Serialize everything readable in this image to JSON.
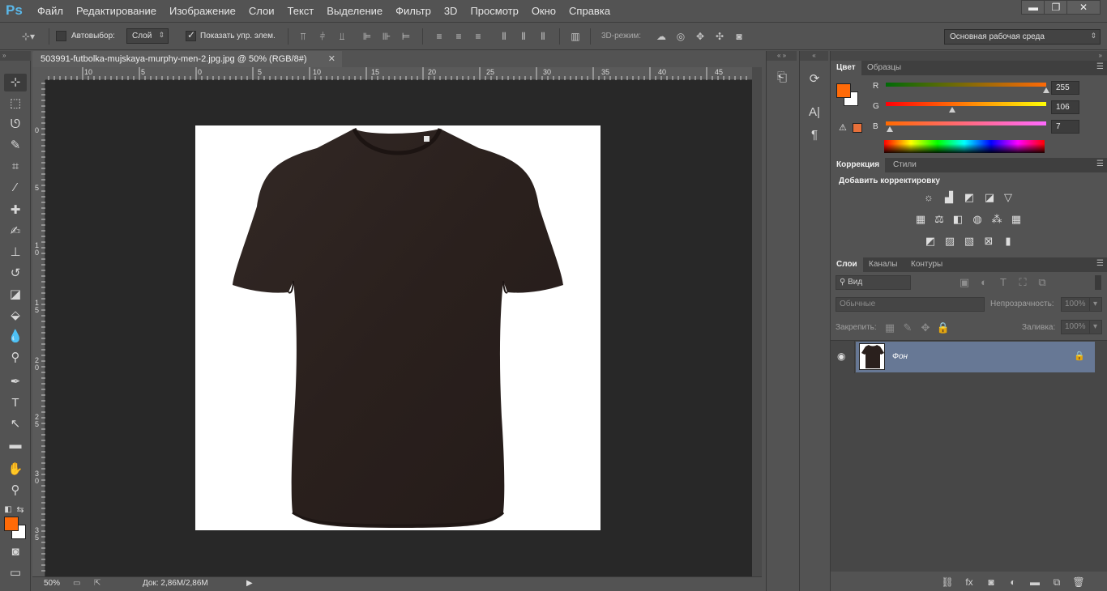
{
  "app": {
    "logo": "Ps",
    "menu": [
      "Файл",
      "Редактирование",
      "Изображение",
      "Слои",
      "Текст",
      "Выделение",
      "Фильтр",
      "3D",
      "Просмотр",
      "Окно",
      "Справка"
    ],
    "window_controls": {
      "minimize": "▬",
      "restore": "❐",
      "close": "✕"
    }
  },
  "options_bar": {
    "autoselect_label": "Автовыбор:",
    "autoselect_checked": false,
    "autoselect_target": "Слой",
    "show_transform_label": "Показать упр. элем.",
    "show_transform_checked": true,
    "mode_3d_label": "3D-режим:",
    "workspace": "Основная рабочая среда"
  },
  "document": {
    "tab_title": "503991-futbolka-mujskaya-murphy-men-2.jpg.jpg @ 50% (RGB/8#)",
    "close_glyph": "✕",
    "ruler_h": [
      "10",
      "5",
      "0",
      "5",
      "10",
      "15",
      "20",
      "25",
      "30",
      "35",
      "40",
      "45"
    ],
    "ruler_v": [
      "0",
      "5",
      "1 0",
      "1 5",
      "2 0",
      "2 5",
      "3 0",
      "3 5"
    ],
    "image_description_colors": {
      "shirt": "#2a2220",
      "background": "#ffffff"
    }
  },
  "status": {
    "zoom": "50%",
    "doc_size": "Док: 2,86M/2,86M"
  },
  "tools": {
    "foreground_color": "#ff6a07",
    "background_color": "#ffffff"
  },
  "color_panel": {
    "tab_color": "Цвет",
    "tab_swatches": "Образцы",
    "r_label": "R",
    "g_label": "G",
    "b_label": "B",
    "r_value": "255",
    "g_value": "106",
    "b_value": "7",
    "r_fraction": 1.0,
    "g_fraction": 0.416,
    "b_fraction": 0.027,
    "current_color": "#ff6a07",
    "warning_swatch": "#e8703a"
  },
  "adjustments_panel": {
    "tab_adjustments": "Коррекция",
    "tab_styles": "Стили",
    "add_label": "Добавить корректировку"
  },
  "layers_panel": {
    "tab_layers": "Слои",
    "tab_channels": "Каналы",
    "tab_paths": "Контуры",
    "filter_kind": "Вид",
    "blend_mode": "Обычные",
    "opacity_label": "Непрозрачность:",
    "opacity_value": "100%",
    "lock_label": "Закрепить:",
    "fill_label": "Заливка:",
    "fill_value": "100%",
    "layers": [
      {
        "name": "Фон",
        "visible": true,
        "locked": true,
        "selected": true
      }
    ]
  }
}
